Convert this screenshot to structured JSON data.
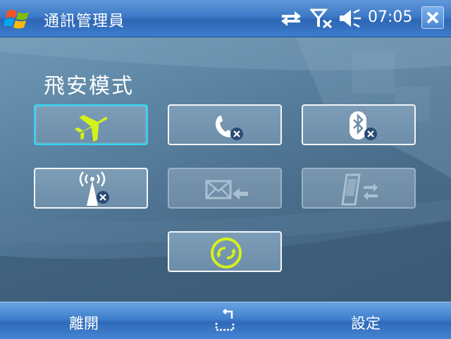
{
  "titlebar": {
    "start_icon": "windows-flag-icon",
    "title": "通訊管理員",
    "status_icons": [
      "connectivity-arrows-icon",
      "signal-off-icon",
      "volume-muted-icon"
    ],
    "time": "07:05",
    "close_icon": "close-icon"
  },
  "main": {
    "heading": "飛安模式",
    "tiles": [
      {
        "icon": "airplane-icon",
        "state": "selected"
      },
      {
        "icon": "phone-off-icon",
        "state": "off"
      },
      {
        "icon": "bluetooth-off-icon",
        "state": "off"
      },
      {
        "icon": "wireless-off-icon",
        "state": "off"
      },
      {
        "icon": "direct-push-icon",
        "state": "disabled"
      },
      {
        "icon": "activesync-device-icon",
        "state": "disabled"
      },
      {
        "icon": "sync-icon",
        "state": "on"
      }
    ]
  },
  "softkeys": {
    "left": "離開",
    "right": "設定",
    "sip_icon": "keyboard-sip-icon"
  },
  "colors": {
    "accent_icon": "#d4f21a",
    "selected_border": "#32d7f2",
    "titlebar": "#3c79c6"
  }
}
